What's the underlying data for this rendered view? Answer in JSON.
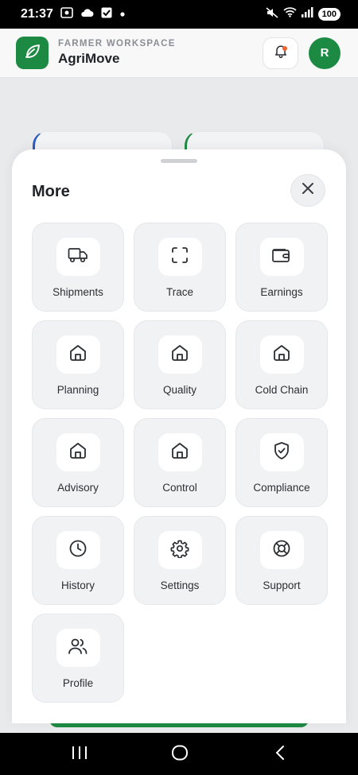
{
  "status_bar": {
    "time": "21:37",
    "battery": "100"
  },
  "header": {
    "workspace_label": "FARMER WORKSPACE",
    "app_name": "AgriMove",
    "avatar_initial": "R",
    "brand_color": "#1d8a43",
    "notification_dot_color": "#f0642f"
  },
  "sheet": {
    "title": "More",
    "items": [
      {
        "label": "Shipments",
        "icon": "truck-icon"
      },
      {
        "label": "Trace",
        "icon": "scan-icon"
      },
      {
        "label": "Earnings",
        "icon": "wallet-icon"
      },
      {
        "label": "Planning",
        "icon": "home-icon"
      },
      {
        "label": "Quality",
        "icon": "home-icon"
      },
      {
        "label": "Cold Chain",
        "icon": "home-icon"
      },
      {
        "label": "Advisory",
        "icon": "home-icon"
      },
      {
        "label": "Control",
        "icon": "home-icon"
      },
      {
        "label": "Compliance",
        "icon": "shield-check-icon"
      },
      {
        "label": "History",
        "icon": "clock-icon"
      },
      {
        "label": "Settings",
        "icon": "gear-icon"
      },
      {
        "label": "Support",
        "icon": "lifebuoy-icon"
      },
      {
        "label": "Profile",
        "icon": "users-icon"
      }
    ]
  }
}
